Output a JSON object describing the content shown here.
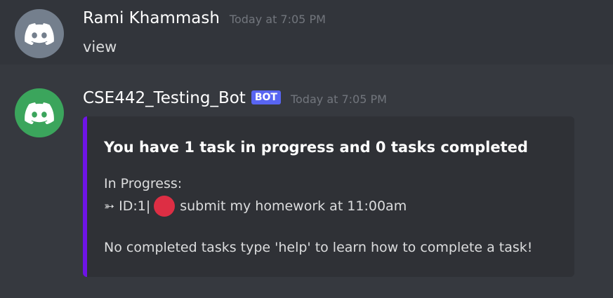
{
  "messages": [
    {
      "username": "Rami Khammash",
      "timestamp": "Today at 7:05 PM",
      "text": "view",
      "avatar_icon": "discord-logo-icon",
      "avatar_color": "#747f8d"
    },
    {
      "username": "CSE442_Testing_Bot",
      "bot_tag": "BOT",
      "timestamp": "Today at 7:05 PM",
      "avatar_icon": "discord-logo-icon",
      "avatar_color": "#3ba55c",
      "embed": {
        "accent_color": "#6e14e6",
        "title": "You have 1 task in progress and 0 tasks completed",
        "in_progress_label": "In Progress:",
        "task_arrow": "➳",
        "task_id": "ID:1|",
        "task_status_icon": "red-circle-icon",
        "task_text": "submit my homework at 11:00am",
        "footer": "No completed tasks type 'help' to learn how to complete a task!"
      }
    }
  ]
}
